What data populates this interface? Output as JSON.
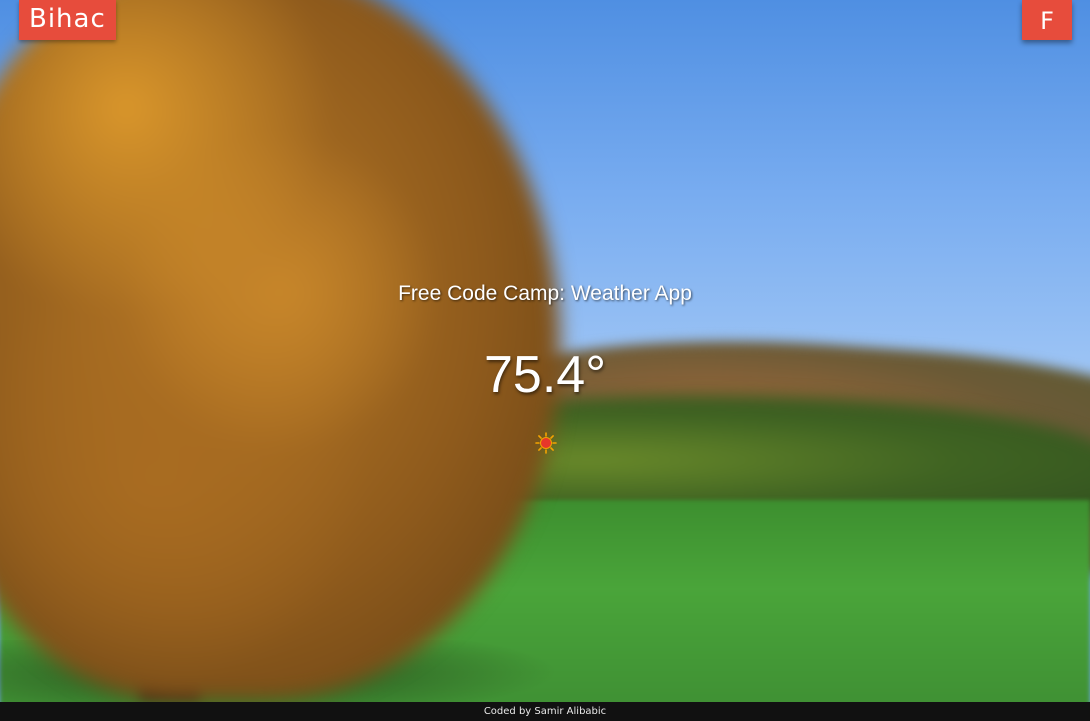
{
  "header": {
    "city": "Bihac",
    "unit_toggle_label": "F"
  },
  "main": {
    "title": "Free Code Camp: Weather App",
    "temperature": "75.4°",
    "weather_icon": "sun-icon"
  },
  "footer": {
    "credit": "Coded by Samir Alibabic"
  },
  "colors": {
    "accent": "#e74c3c",
    "footer_bg": "#111111",
    "sun": "#e7372a",
    "sun_rays": "#f5a300"
  }
}
